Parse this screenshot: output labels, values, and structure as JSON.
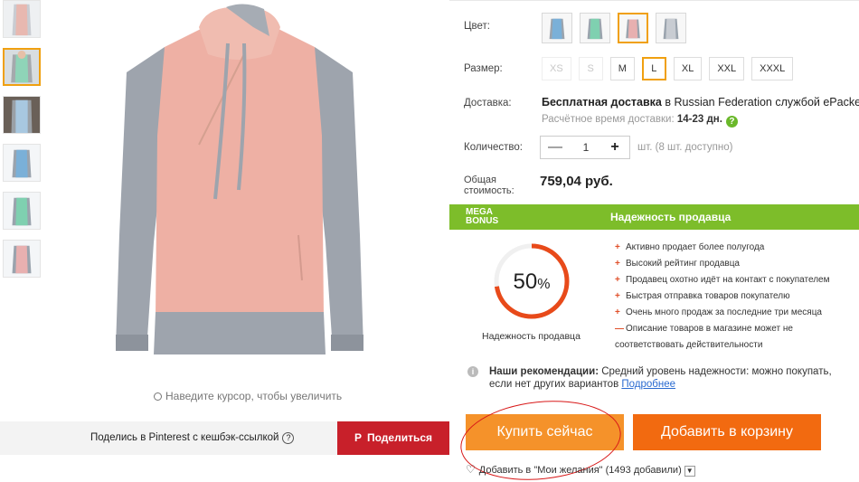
{
  "thumbnails": [
    {
      "name": "thumb-1",
      "selected": false
    },
    {
      "name": "thumb-2",
      "selected": true
    },
    {
      "name": "thumb-3",
      "selected": false
    },
    {
      "name": "thumb-4",
      "selected": false
    },
    {
      "name": "thumb-5",
      "selected": false
    },
    {
      "name": "thumb-6",
      "selected": false
    }
  ],
  "zoom_hint": "Наведите курсор, чтобы увеличить",
  "pinterest": {
    "text": "Поделись в Pinterest с кешбэк-ссылкой",
    "help": "?",
    "button_label": "Поделиться",
    "button_icon": "P"
  },
  "product": {
    "color_label": "Цвет:",
    "size_label": "Размер:",
    "sizes": [
      "XS",
      "S",
      "M",
      "L",
      "XL",
      "XXL",
      "XXXL"
    ],
    "disabled_sizes": [
      "XS",
      "S"
    ],
    "selected_size": "L",
    "shipping_label": "Доставка:",
    "shipping_free": "Бесплатная доставка",
    "shipping_rest": " в Russian Federation службой ePacket",
    "delivery_time_label": "Расчётное время доставки: ",
    "delivery_time": "14-23 дн.",
    "delivery_help": "?",
    "qty_label": "Количество:",
    "qty_minus": "—",
    "qty_value": "1",
    "qty_plus": "+",
    "qty_available": "шт. (8 шт. доступно)",
    "total_label_1": "Общая",
    "total_label_2": "стоимость:",
    "total_value": "759,04 руб."
  },
  "reliability": {
    "mega_1": "MEGA",
    "mega_2": "BONUS",
    "title": "Надежность продавца",
    "percent_num": "50",
    "percent_sign": "%",
    "percent_value": 0.5,
    "gauge_label": "Надежность продавца",
    "reasons": [
      {
        "mark": "+",
        "text": "Активно продает более полугода"
      },
      {
        "mark": "+",
        "text": "Высокий рейтинг продавца"
      },
      {
        "mark": "+",
        "text": "Продавец охотно идёт на контакт с покупателем"
      },
      {
        "mark": "+",
        "text": "Быстрая отправка товаров покупателю"
      },
      {
        "mark": "+",
        "text": "Очень много продаж за последние три месяца"
      },
      {
        "mark": "—",
        "text": "Описание товаров в магазине может не"
      },
      {
        "mark": "",
        "text": "соответствовать действительности"
      }
    ],
    "reco_bold": "Наши рекомендации:",
    "reco_text": " Средний уровень надежности: можно покупать, если нет других вариантов ",
    "reco_link": "Подробнее"
  },
  "actions": {
    "buy_now": "Купить сейчас",
    "add_to_cart": "Добавить в корзину",
    "wishlist": "Добавить в \"Мои желания\" (1493 добавили)"
  },
  "colors": {
    "accent_orange": "#f0a010",
    "buy_orange": "#f5922a",
    "cart_orange": "#f26a10",
    "green": "#7dbd2a",
    "pinterest_red": "#c8202a",
    "gauge_red": "#e84a1a"
  }
}
